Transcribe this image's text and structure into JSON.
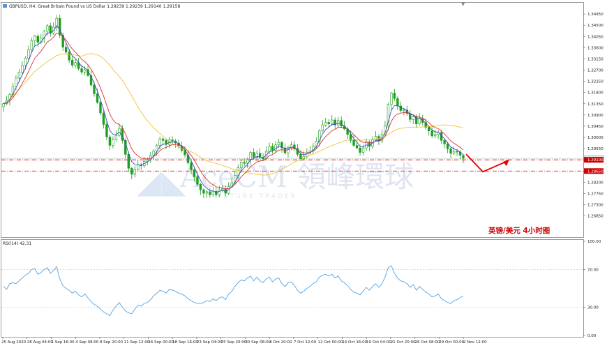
{
  "chart_title": "GBPUSD, H4:  Great Britain Pound vs US Dollar  1.29239 1.29239 1.29140 1.29158",
  "annotation": "英镑/美元   4小时图",
  "watermark": {
    "main": "AceCM 領峰環球",
    "sub": "FUTURE TRADER"
  },
  "colors": {
    "candle": "#1e9e1e",
    "ma_fast": "#3b4fc4",
    "ma_mid": "#e03030",
    "ma_slow": "#f2c13a",
    "rsi": "#4ea3e6",
    "resistance": "#cc0000",
    "arrow": "#e60000",
    "annotation": "#cc0000"
  },
  "chart_data": [
    {
      "type": "candlestick",
      "ylim": [
        1.26,
        1.354
      ],
      "y_ticks": [
        "1.34950",
        "1.34500",
        "1.34050",
        "1.33600",
        "1.33150",
        "1.32700",
        "1.32250",
        "1.31800",
        "1.31350",
        "1.30900",
        "1.30450",
        "1.30000",
        "1.29550",
        "1.29158",
        "1.29100",
        "1.28650",
        "1.28200",
        "1.27750",
        "1.27300",
        "1.26850"
      ],
      "current_price": 1.29158,
      "levels": [
        {
          "label": "1.29100",
          "value": 1.291
        },
        {
          "label": "1.28650",
          "value": 1.2865
        }
      ],
      "x_labels": [
        "25 Aug 2020",
        "28 Aug 04:00",
        "1 Sep 16:00",
        "4 Sep 08:00",
        "8 Sep 20:00",
        "11 Sep 12:00",
        "16 Sep 00:00",
        "18 Sep 16:00",
        "23 Sep 04:00",
        "25 Sep 20:00",
        "30 Sep 08:00",
        "4 Oct 20:00",
        "7 Oct 12:00",
        "12 Oct 00:00",
        "14 Oct 16:00",
        "19 Oct 04:00",
        "21 Oct 20:00",
        "26 Oct 08:00",
        "29 Oct 00:00",
        "2 Nov 12:00"
      ],
      "closes": [
        1.3135,
        1.3148,
        1.3172,
        1.3205,
        1.3238,
        1.3262,
        1.329,
        1.3318,
        1.3352,
        1.3388,
        1.3406,
        1.3382,
        1.3398,
        1.3426,
        1.3448,
        1.3418,
        1.3442,
        1.3478,
        1.341,
        1.3362,
        1.3342,
        1.331,
        1.329,
        1.33,
        1.3276,
        1.3262,
        1.3272,
        1.3248,
        1.321,
        1.3175,
        1.314,
        1.3098,
        1.3052,
        1.3002,
        1.2968,
        1.299,
        1.3008,
        1.3036,
        1.2988,
        1.2932,
        1.2876,
        1.2852,
        1.2872,
        1.289,
        1.2886,
        1.2904,
        1.291,
        1.2928,
        1.2946,
        1.2968,
        1.2994,
        1.2988,
        1.2972,
        1.299,
        1.2986,
        1.2978,
        1.2966,
        1.2948,
        1.293,
        1.2898,
        1.287,
        1.2842,
        1.2812,
        1.279,
        1.2776,
        1.2782,
        1.277,
        1.2784,
        1.277,
        1.279,
        1.2794,
        1.2776,
        1.2802,
        1.2818,
        1.2848,
        1.2878,
        1.29,
        1.2896,
        1.2912,
        1.294,
        1.292,
        1.2936,
        1.292,
        1.2914,
        1.2944,
        1.2964,
        1.2948,
        1.297,
        1.298,
        1.2958,
        1.2938,
        1.296,
        1.297,
        1.2956,
        1.2932,
        1.2914,
        1.2924,
        1.2938,
        1.2946,
        1.2964,
        1.2984,
        1.3026,
        1.305,
        1.306,
        1.3054,
        1.307,
        1.305,
        1.3068,
        1.3046,
        1.3034,
        1.3012,
        1.2988,
        1.2968,
        1.2958,
        1.294,
        1.2958,
        1.2982,
        1.2964,
        1.299,
        1.3004,
        1.2986,
        1.3012,
        1.3046,
        1.3132,
        1.3178,
        1.3156,
        1.3126,
        1.3108,
        1.311,
        1.3096,
        1.3072,
        1.3084,
        1.3054,
        1.3076,
        1.306,
        1.304,
        1.3026,
        1.3006,
        1.3012,
        1.302,
        1.2988,
        1.2974,
        1.2954,
        1.2936,
        1.2944,
        1.2942,
        1.2928,
        1.2916
      ]
    },
    {
      "type": "line",
      "title": "RSI(14) 42.31",
      "ylim": [
        0,
        100
      ],
      "y_ticks": [
        100,
        70,
        30,
        0
      ],
      "y_tick_labels": [
        "100.00",
        "70.00",
        "30.00",
        "0.00"
      ],
      "levels": [
        70,
        30
      ],
      "values": [
        52,
        49,
        55,
        56,
        55,
        58,
        61,
        64,
        66,
        70,
        71,
        65,
        67,
        70,
        72,
        66,
        69,
        73,
        60,
        53,
        50,
        48,
        45,
        47,
        43,
        41,
        44,
        40,
        36,
        33,
        31,
        28,
        25,
        23,
        21,
        27,
        31,
        35,
        30,
        26,
        24,
        23,
        28,
        32,
        31,
        34,
        35,
        38,
        42,
        45,
        48,
        47,
        45,
        49,
        48,
        47,
        45,
        44,
        42,
        39,
        37,
        35,
        34,
        34,
        35,
        37,
        36,
        39,
        37,
        40,
        41,
        38,
        44,
        47,
        52,
        56,
        59,
        58,
        61,
        63,
        58,
        62,
        58,
        56,
        60,
        62,
        57,
        60,
        61,
        55,
        52,
        56,
        57,
        53,
        48,
        45,
        47,
        50,
        52,
        55,
        57,
        62,
        64,
        65,
        63,
        65,
        61,
        63,
        58,
        56,
        53,
        49,
        46,
        45,
        43,
        47,
        51,
        48,
        52,
        55,
        51,
        55,
        62,
        72,
        74,
        66,
        61,
        58,
        57,
        55,
        51,
        54,
        48,
        52,
        49,
        46,
        44,
        41,
        42,
        44,
        39,
        37,
        35,
        34,
        37,
        38,
        40,
        42
      ]
    }
  ]
}
